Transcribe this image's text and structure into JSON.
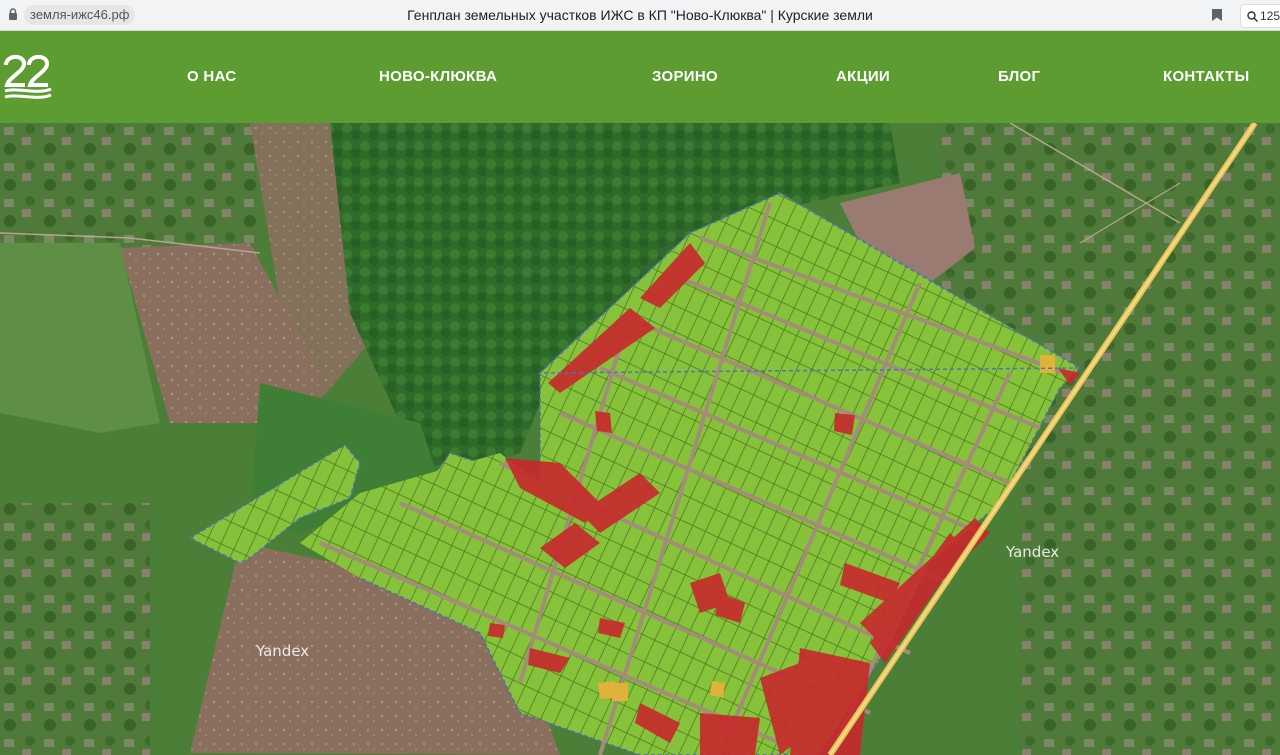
{
  "browser": {
    "url": "земля-ижс46.рф",
    "tab_title": "Генплан земельных участков ИЖС в КП \"Ново-Клюква\" | Курские земли",
    "zoom": "125"
  },
  "nav": {
    "items": [
      "О НАС",
      "НОВО-КЛЮКВА",
      "ЗОРИНО",
      "АКЦИИ",
      "БЛОГ",
      "КОНТАКТЫ"
    ]
  },
  "map": {
    "watermarks": [
      "Yandex",
      "Yandex"
    ],
    "plot_status_colors": {
      "available": "#86c23a",
      "sold": "#c8282c",
      "reserved": "#e0b23a"
    },
    "road_color": "#e8c45a",
    "accent_color": "#5d9c31"
  }
}
